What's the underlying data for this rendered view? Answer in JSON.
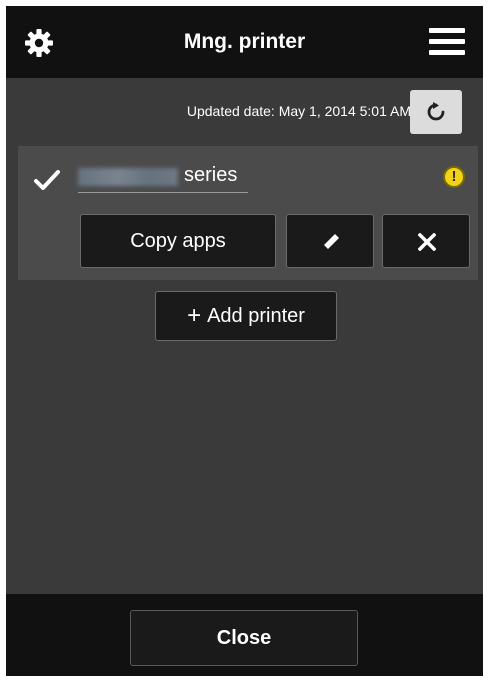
{
  "header": {
    "settings_icon": "gear-icon",
    "title": "Mng. printer",
    "menu_icon": "hamburger-menu-icon"
  },
  "status": {
    "updated_text": "Updated date: May 1, 2014 5:01 AM",
    "refresh_icon": "refresh-icon"
  },
  "printer": {
    "selected": true,
    "name_suffix": "series",
    "warning_icon": "warning-icon",
    "warning_symbol": "!",
    "copy_apps_label": "Copy apps",
    "edit_icon": "pencil-icon",
    "delete_icon": "close-x-icon"
  },
  "actions": {
    "add_printer_symbol": "+",
    "add_printer_label": "Add printer"
  },
  "footer": {
    "close_label": "Close"
  },
  "colors": {
    "header_bg": "#111111",
    "body_bg": "#3a3a3a",
    "card_bg": "#4b4b4b",
    "warning": "#f3d21a"
  }
}
